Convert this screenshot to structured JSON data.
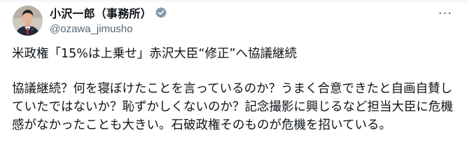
{
  "user": {
    "display_name": "小沢一郎（事務所）",
    "handle": "@ozawa_jimusho"
  },
  "icons": {
    "verified": "verified-badge-icon",
    "more": "more-options-icon"
  },
  "colors": {
    "verified_badge": "#829aab",
    "text_primary": "#0f1419",
    "text_secondary": "#536471"
  },
  "tweet": {
    "headline": "米政権「15%は上乗せ」赤沢大臣“修正”へ協議継続",
    "paragraph": "協議継続？何を寝ぼけたことを言っているのか？うまく合意できたと自画自賛していたではないか？恥ずかしくないのか？記念撮影に興じるなど担当大臣に危機感がなかったことも大きい。石破政権そのものが危機を招いている。"
  },
  "more_label": "···"
}
